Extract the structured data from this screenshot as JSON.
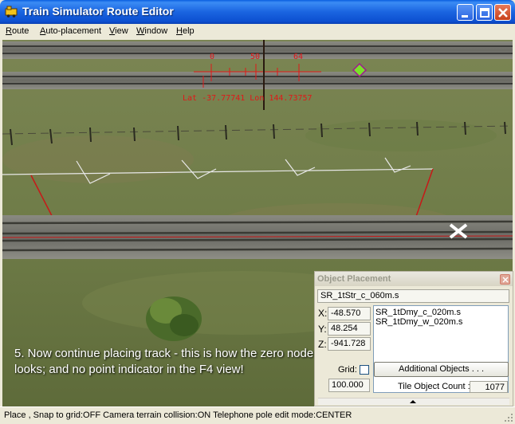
{
  "window": {
    "title": "Train Simulator Route Editor",
    "buttons": {
      "minimize": "minimize",
      "maximize": "maximize",
      "close": "close"
    }
  },
  "menu": {
    "items": [
      {
        "label": "Route",
        "underline": "R",
        "rest": "oute"
      },
      {
        "label": "Auto-placement",
        "underline": "A",
        "rest": "uto-placement"
      },
      {
        "label": "View",
        "underline": "V",
        "rest": "iew"
      },
      {
        "label": "Window",
        "underline": "W",
        "rest": "indow"
      },
      {
        "label": "Help",
        "underline": "H",
        "rest": "elp"
      }
    ]
  },
  "viewport": {
    "ruler_ticks": [
      "0",
      "50",
      "64"
    ],
    "lat_lon": "Lat -37.77741 Lon 144.73757",
    "caption": "5. Now continue placing track - this is how the zero node looks; and no point indicator in the F4 view!"
  },
  "object_placement": {
    "title": "Object Placement",
    "current_object": "SR_1tStr_c_060m.s",
    "x_label": "X:",
    "y_label": "Y:",
    "z_label": "Z:",
    "x_value": "-48.570",
    "y_value": "48.254",
    "z_value": "-941.728",
    "objects": [
      "SR_1tDmy_c_020m.s",
      "SR_1tDmy_w_020m.s"
    ],
    "grid_label": "Grid:",
    "grid_checked": false,
    "grid_value": "100.000",
    "additional_objects_label": "Additional Objects . . .",
    "tile_object_count_label": "Tile Object Count :",
    "tile_object_count": "1077"
  },
  "status": {
    "text": "Place , Snap to grid:OFF Camera terrain collision:ON Telephone pole edit mode:CENTER"
  },
  "colors": {
    "titlebar": "#0c4fd0",
    "ruler": "#e01818",
    "window_face": "#ece9d8"
  }
}
